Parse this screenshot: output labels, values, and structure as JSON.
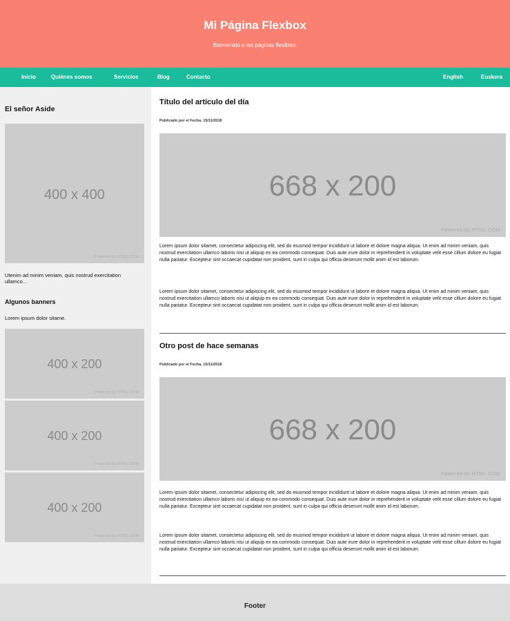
{
  "header": {
    "title": "Mi Página Flexbox",
    "subtitle": "Bienvenido a las páginas flexibles."
  },
  "nav": {
    "links": [
      "Inicio",
      "Quiénes somos",
      "Servicios",
      "Blog",
      "Contacto"
    ],
    "languages": [
      "English",
      "Euskera"
    ]
  },
  "colors": {
    "header_bg": "#fa8072",
    "nav_bg": "#1abc9c",
    "aside_bg": "#f0f0f0",
    "placeholder_bg": "#cccccc",
    "footer_bg": "#dddddd"
  },
  "aside": {
    "title": "El señor Aside",
    "image_label": "400 x 400",
    "image_credit": "Powered by HTML.COM",
    "text": "Utenim ad minim veniam, quis nostrud exercitation ullamco...",
    "banners_title": "Algunos banners",
    "banners_text": "Lorem ipsum dolor sitame.",
    "banners": [
      {
        "label": "400 x 200",
        "credit": "Powered by HTML.COM"
      },
      {
        "label": "400 x 200",
        "credit": "Powered by HTML.COM"
      },
      {
        "label": "400 x 200",
        "credit": "Powered by HTML.COM"
      }
    ]
  },
  "articles": [
    {
      "title": "Título del artículo del día",
      "meta": "Publicado por el Fecha, 15/11/2018",
      "image_label": "668 x 200",
      "image_credit": "Powered by HTML.COM",
      "paragraphs": [
        "Lorem ipsum dolor sitamet, consectetur adipiscing elit, sed do eiusmod tempor incididunt ut labore et dolore magna aliqua. Ut enim ad minim veniam, quis nostrud exercitation ullamco laboris nisi ut aliquip ex ea commodo consequat. Duis aute irure dolor in reprehenderit in voluptate velit esse cillum dolore eu fugiat nulla pariatur. Excepteur sint occaecat cupidatat non proident, sunt in culpa qui officia deserunt mollit anim id est laborum.",
        "Lorem ipsum dolor sitamet, consectetur adipiscing elit, sed do eiusmod tempor incididunt ut labore et dolore magna aliqua. Ut enim ad minim veniam, quis nostrud exercitation ullamco laboris nisi ut aliquip ex ea commodo consequat. Duis aute irure dolor in reprehenderit in voluptate velit esse cillum dolore eu fugiat nulla pariatur. Excepteur sint occaecat cupidatat non proident, sunt in culpa qui officia deserunt mollit anim id est laborum."
      ]
    },
    {
      "title": "Otro post de hace semanas",
      "meta": "Publicado por el Fecha, 15/11/2018",
      "image_label": "668 x 200",
      "image_credit": "Powered by HTML.COM",
      "paragraphs": [
        "Lorem ipsum dolor sitamet, consectetur adipiscing elit, sed do eiusmod tempor incididunt ut labore et dolore magna aliqua. Ut enim ad minim veniam, quis nostrud exercitation ullamco laboris nisi ut aliquip ex ea commodo consequat. Duis aute irure dolor in reprehenderit in voluptate velit esse cillum dolore eu fugiat nulla pariatur. Excepteur sint occaecat cupidatat non proident, sunt in culpa qui officia deserunt mollit anim id est laborum.",
        "Lorem ipsum dolor sitamet, consectetur adipiscing elit, sed do eiusmod tempor incididunt ut labore et dolore magna aliqua. Ut enim ad minim veniam, quis nostrud exercitation ullamco laboris nisi ut aliquip ex ea commodo consequat. Duis aute irure dolor in reprehenderit in voluptate velit esse cillum dolore eu fugiat nulla pariatur. Excepteur sint occaecat cupidatat non proident, sunt in culpa qui officia deserunt mollit anim id est laborum."
      ]
    }
  ],
  "footer": {
    "text": "Footer"
  }
}
